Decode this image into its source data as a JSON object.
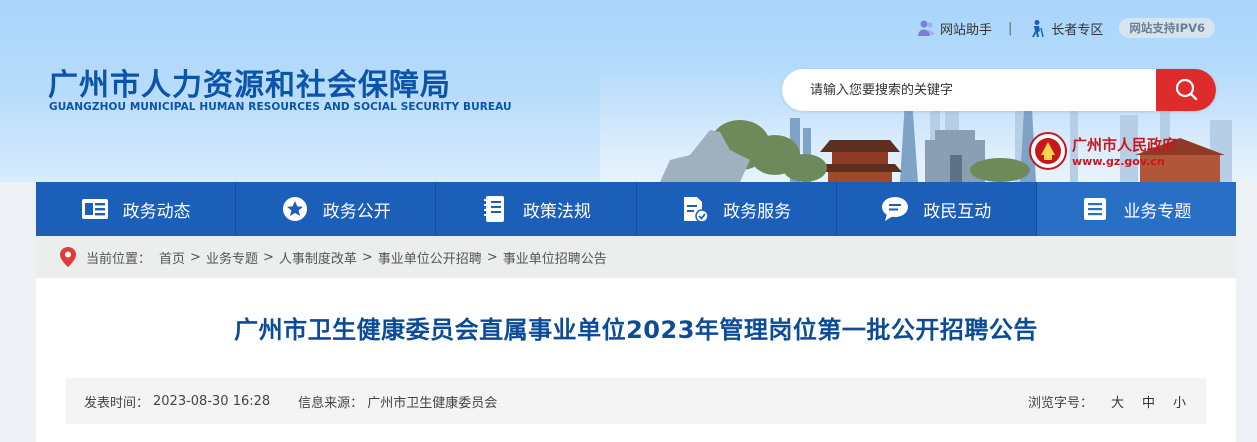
{
  "header": {
    "top_links": {
      "assistant": "网站助手",
      "senior": "长者专区",
      "ipv6": "网站支持IPV6"
    },
    "logo_cn": "广州市人力资源和社会保障局",
    "logo_en": "GUANGZHOU MUNICIPAL HUMAN RESOURCES AND SOCIAL SECURITY BUREAU",
    "search": {
      "placeholder": "请输入您要搜索的关键字"
    },
    "gov_logo": {
      "name": "广州市人民政府",
      "url": "www.gz.gov.cn"
    }
  },
  "nav": {
    "items": [
      {
        "label": "政务动态",
        "icon": "news-icon"
      },
      {
        "label": "政务公开",
        "icon": "star-icon"
      },
      {
        "label": "政策法规",
        "icon": "document-icon"
      },
      {
        "label": "政务服务",
        "icon": "service-icon"
      },
      {
        "label": "政民互动",
        "icon": "chat-icon"
      },
      {
        "label": "业务专题",
        "icon": "list-icon"
      }
    ]
  },
  "breadcrumb": {
    "prefix": "当前位置：",
    "items": [
      "首页",
      "业务专题",
      "人事制度改革",
      "事业单位公开招聘",
      "事业单位招聘公告"
    ],
    "separator": ">"
  },
  "article": {
    "title": "广州市卫生健康委员会直属事业单位2023年管理岗位第一批公开招聘公告",
    "publish_label": "发表时间：",
    "publish_time": "2023-08-30 16:28",
    "source_label": "信息来源：",
    "source": "广州市卫生健康委员会",
    "font_size_label": "浏览字号：",
    "font_sizes": [
      "大",
      "中",
      "小"
    ]
  },
  "colors": {
    "brand_blue": "#0b54a9",
    "nav_blue": "#1b5fb8",
    "search_red": "#de2b2b",
    "gov_red": "#c8161d"
  }
}
